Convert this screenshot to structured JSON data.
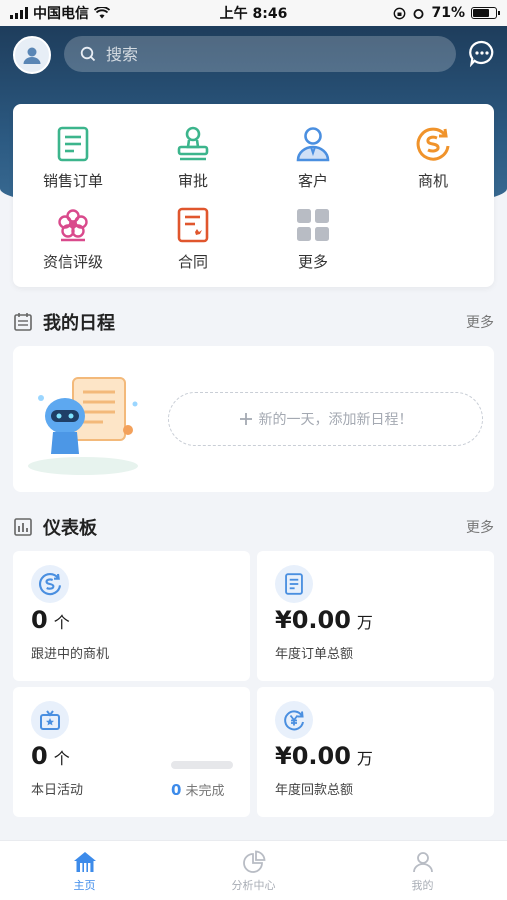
{
  "status_bar": {
    "carrier": "中国电信",
    "time": "上午 8:46",
    "battery": "71%",
    "battery_level": 0.71
  },
  "header": {
    "search_placeholder": "搜索"
  },
  "quick_menu": [
    {
      "label": "销售订单",
      "icon": "sales-order-icon",
      "color": "#3cb58c"
    },
    {
      "label": "审批",
      "icon": "approval-stamp-icon",
      "color": "#3cb58c"
    },
    {
      "label": "客户",
      "icon": "customer-icon",
      "color": "#4a8fe0"
    },
    {
      "label": "商机",
      "icon": "business-opportunity-icon",
      "color": "#f0932b"
    },
    {
      "label": "资信评级",
      "icon": "credit-rating-flower-icon",
      "color": "#d94a8c"
    },
    {
      "label": "合同",
      "icon": "contract-icon",
      "color": "#e0562d"
    },
    {
      "label": "更多",
      "icon": "grid-more-icon",
      "color": "#b8bcc4"
    }
  ],
  "schedule": {
    "title": "我的日程",
    "more": "更多",
    "add_text": "新的一天，添加新日程！"
  },
  "dashboard": {
    "title": "仪表板",
    "more": "更多",
    "cards": [
      {
        "value": "0",
        "unit": "个",
        "label": "跟进中的商机",
        "icon": "business-opportunity-icon"
      },
      {
        "value": "¥0.00",
        "unit": "万",
        "label": "年度订单总额",
        "icon": "document-icon"
      },
      {
        "value": "0",
        "unit": "个",
        "label": "本日活动",
        "icon": "activity-star-icon",
        "incomplete_count": "0",
        "incomplete_label": "未完成",
        "progress": 0
      },
      {
        "value": "¥0.00",
        "unit": "万",
        "label": "年度回款总额",
        "icon": "payment-yen-icon"
      }
    ]
  },
  "bottom_nav": [
    {
      "label": "主页",
      "icon": "home-icon",
      "active": true
    },
    {
      "label": "分析中心",
      "icon": "analysis-pie-icon",
      "active": false
    },
    {
      "label": "我的",
      "icon": "profile-icon",
      "active": false
    }
  ],
  "colors": {
    "header_bg": "#1e3d5c",
    "accent": "#3d8bea"
  }
}
